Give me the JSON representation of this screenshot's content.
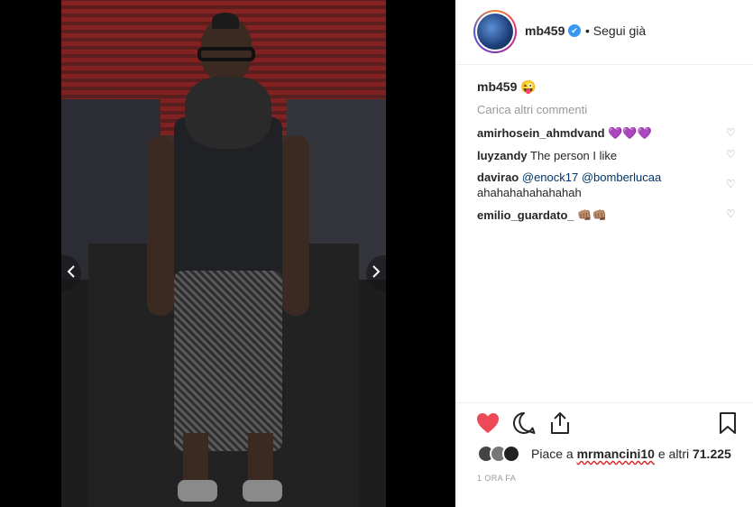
{
  "post": {
    "username": "mb459",
    "follow_status": "• Segui già",
    "caption_user": "mb459",
    "caption_text": "😜",
    "load_more": "Carica altri commenti"
  },
  "comments": [
    {
      "user": "amirhosein_ahmdvand",
      "text": "💜💜💜"
    },
    {
      "user": "luyzandy",
      "text": "The person I like"
    },
    {
      "user": "davirao",
      "mention1": "@enock17",
      "mention2": "@bomberlucaa",
      "text": "ahahahahahahahah"
    },
    {
      "user": "emilio_guardato_",
      "text": "👊🏽👊🏽"
    }
  ],
  "likes": {
    "prefix": "Piace a",
    "user": "mrmancini10",
    "middle": "e altri",
    "count": "71.225"
  },
  "timestamp": "1 ORA FA",
  "icons": {
    "like": "heart-filled-icon",
    "comment": "comment-bubble-icon",
    "share": "share-upload-icon",
    "save": "bookmark-icon",
    "prev": "chevron-left-icon",
    "next": "chevron-right-icon",
    "verified": "verified-badge-icon"
  },
  "colors": {
    "like_red": "#ed4956",
    "verified_blue": "#3897f0",
    "mention_blue": "#003569",
    "muted_gray": "#999999"
  }
}
